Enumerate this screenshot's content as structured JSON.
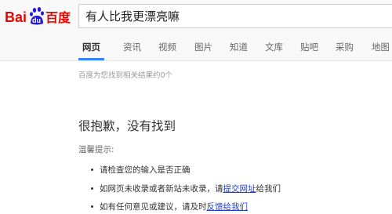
{
  "logo": {
    "text_left": "Bai",
    "paw_text": "du",
    "text_right": "百度"
  },
  "search": {
    "query": "有人比我更漂亮嘛"
  },
  "nav": {
    "tabs": [
      {
        "label": "网页",
        "active": true
      },
      {
        "label": "资讯"
      },
      {
        "label": "视频"
      },
      {
        "label": "图片"
      },
      {
        "label": "知道"
      },
      {
        "label": "文库"
      },
      {
        "label": "贴吧"
      },
      {
        "label": "采购"
      },
      {
        "label": "地图"
      }
    ]
  },
  "result_count": "百度为您找到相关结果约0个",
  "no_result": {
    "title": "很抱歉，没有找到",
    "tips_title": "温馨提示:",
    "tips": [
      {
        "text": "请检查您的输入是否正确"
      },
      {
        "text_before": "如网页未收录或者新站未收录，请",
        "link": "提交网址",
        "text_after": "给我们"
      },
      {
        "text_before": "如有任何意见或建议，请及时",
        "link": "反馈给我们",
        "text_after": ""
      }
    ]
  },
  "colors": {
    "brand_red": "#e10602",
    "brand_blue": "#2319dc",
    "active_tab": "#3385ff",
    "link": "#2440b3"
  }
}
